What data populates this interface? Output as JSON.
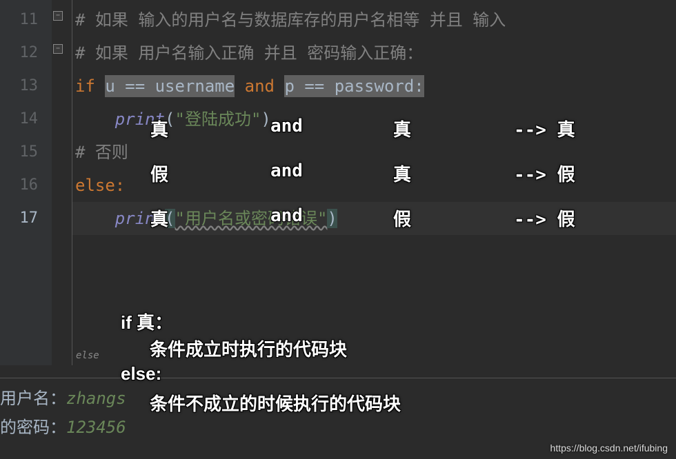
{
  "lineNumbers": [
    "11",
    "12",
    "13",
    "14",
    "15",
    "16",
    "17"
  ],
  "currentLine": 17,
  "foldLabel": "else",
  "code": {
    "line11": "# 如果 输入的用户名与数据库存的用户名相等 并且 输入",
    "line12": "# 如果 用户名输入正确 并且 密码输入正确：",
    "line13": {
      "if": "if ",
      "hl1": "u == username",
      "and": " and ",
      "hl2": "p == password:"
    },
    "line14": {
      "print": "print",
      "open": "(",
      "str": "\"登陆成功\"",
      "close": ")"
    },
    "line15": "# 否则",
    "line16": "else:",
    "line17": {
      "print": "print",
      "open": "(",
      "str": "\"用户名或密码错误\"",
      "close": ")"
    }
  },
  "terminal": {
    "label1": "用户名：",
    "input1": "zhangs",
    "label2": "的密码：",
    "input2": "123456"
  },
  "annotations": {
    "row1": {
      "c1": "真",
      "c2": "and",
      "c3": "真",
      "c4": "--> 真"
    },
    "row2": {
      "c1": "假",
      "c2": "and",
      "c3": "真",
      "c4": "--> 假"
    },
    "row3": {
      "c1": "真",
      "c2": "and",
      "c3": "假",
      "c4": "--> 假"
    },
    "explain": {
      "l1": "if 真：",
      "l2": "条件成立时执行的代码块",
      "l3": "else:",
      "l4": "条件不成立的时候执行的代码块"
    }
  },
  "watermark": "https://blog.csdn.net/ifubing"
}
